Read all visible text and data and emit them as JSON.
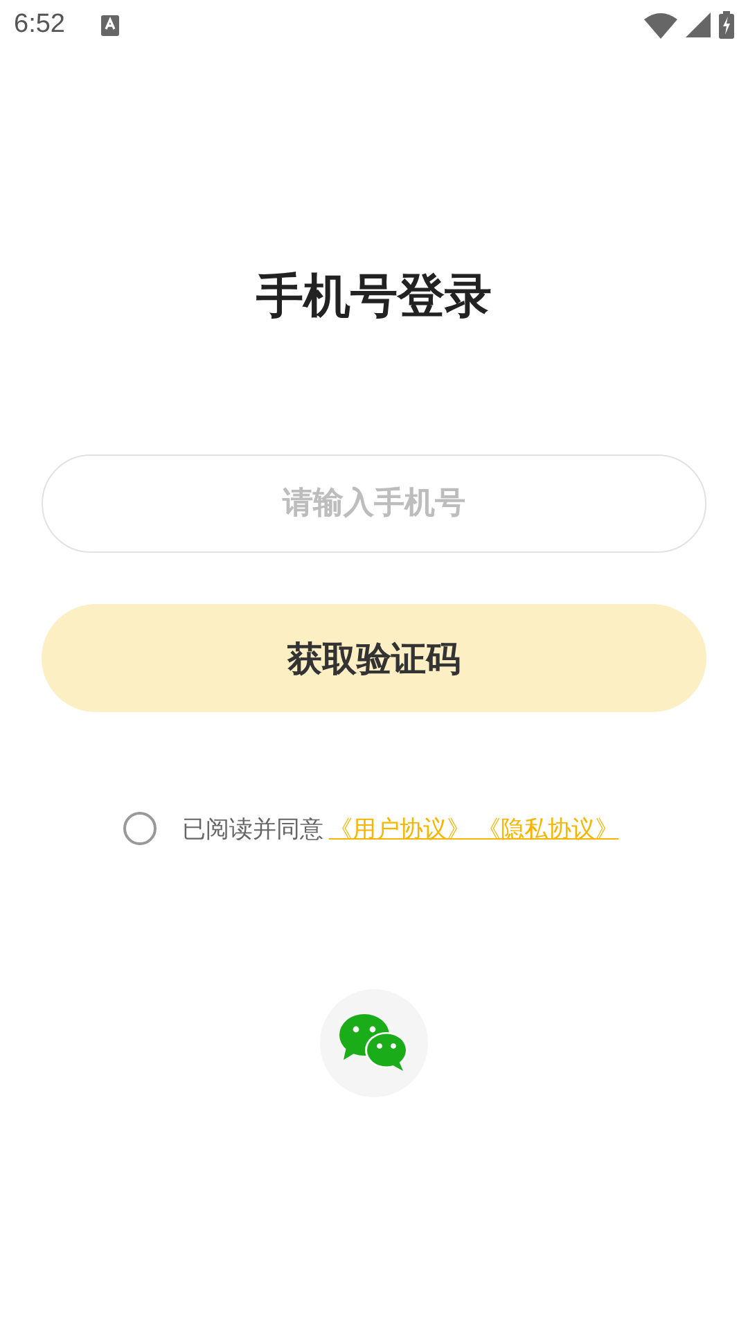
{
  "status_bar": {
    "time": "6:52"
  },
  "title": "手机号登录",
  "phone_field": {
    "placeholder": "请输入手机号"
  },
  "submit_button": {
    "label": "获取验证码",
    "disabled": true
  },
  "agreement": {
    "checked": false,
    "text": "已阅读并同意",
    "link": "《用户协议》 《隐私协议》"
  }
}
